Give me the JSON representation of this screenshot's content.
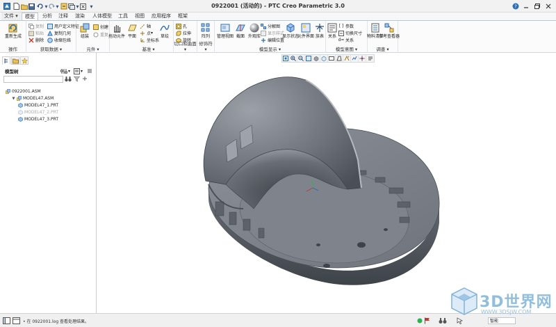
{
  "window": {
    "title": "0922001 (活动的) - PTC Creo Parametric 3.0"
  },
  "menu_tabs": [
    "文件",
    "模型",
    "分析",
    "注释",
    "渲染",
    "人体模型",
    "工具",
    "视图",
    "应用程序",
    "框架"
  ],
  "ribbon": {
    "groups": {
      "operations": "操作",
      "get_data": "获取数据",
      "component": "元件",
      "datum": "基准",
      "cut_surface": "切口和曲面",
      "modifiers": "修饰符",
      "model_display": "模型显示",
      "model_intent": "模型意图",
      "investigate": "调查"
    },
    "buttons": {
      "regenerate": "重新生成",
      "copy": "复制",
      "paste": "粘贴",
      "delete": "删除",
      "user_defined_feature": "用户定义特征",
      "copy_geometry": "复制几何",
      "shrinkwrap": "收缩包络",
      "assemble": "组装",
      "create": "创建",
      "repeat": "重复",
      "drag_components": "拖动元件",
      "plane": "平面",
      "axis": "轴",
      "point": "点",
      "coord_system": "坐标系",
      "sketch": "草绘",
      "hole": "孔",
      "extrude": "拉伸",
      "revolve": "旋转",
      "pattern": "阵列",
      "manage_views": "管理视图",
      "section": "截面",
      "appearance_gallery": "外观库",
      "exploded_view": "分解图",
      "edit_position": "编辑位置",
      "display_style": "显示样式",
      "display_state": "显示状态",
      "element_interface": "元件界面",
      "family_table": "族表",
      "relations": "关系",
      "switch_dimensions": "切换尺寸",
      "parameters": "参数",
      "bill_of_materials": "物料清单",
      "reference_viewer": "参考查看器"
    }
  },
  "navigator": {
    "title": "模型树",
    "search_placeholder": "",
    "items": [
      {
        "label": "0922001.ASM",
        "level": 0,
        "dimmed": false
      },
      {
        "label": "MODEL47.ASM",
        "level": 1,
        "dimmed": false
      },
      {
        "label": "MODEL47_1.PRT",
        "level": 2,
        "dimmed": false
      },
      {
        "label": "MODEL47_2.PRT",
        "level": 2,
        "dimmed": true
      },
      {
        "label": "MODEL47_3.PRT",
        "level": 2,
        "dimmed": false
      }
    ]
  },
  "status": {
    "message": "• 在 0922001.log 查看处理结果。",
    "filter_value": "智能"
  },
  "watermark": {
    "text": "3D世界网",
    "url": "WWW.3DSJW.COM"
  },
  "colors": {
    "model": "#7b8089",
    "model_dark": "#4d525a",
    "model_light": "#a7abb2",
    "ribbon_accent": "#2d6fb5"
  }
}
